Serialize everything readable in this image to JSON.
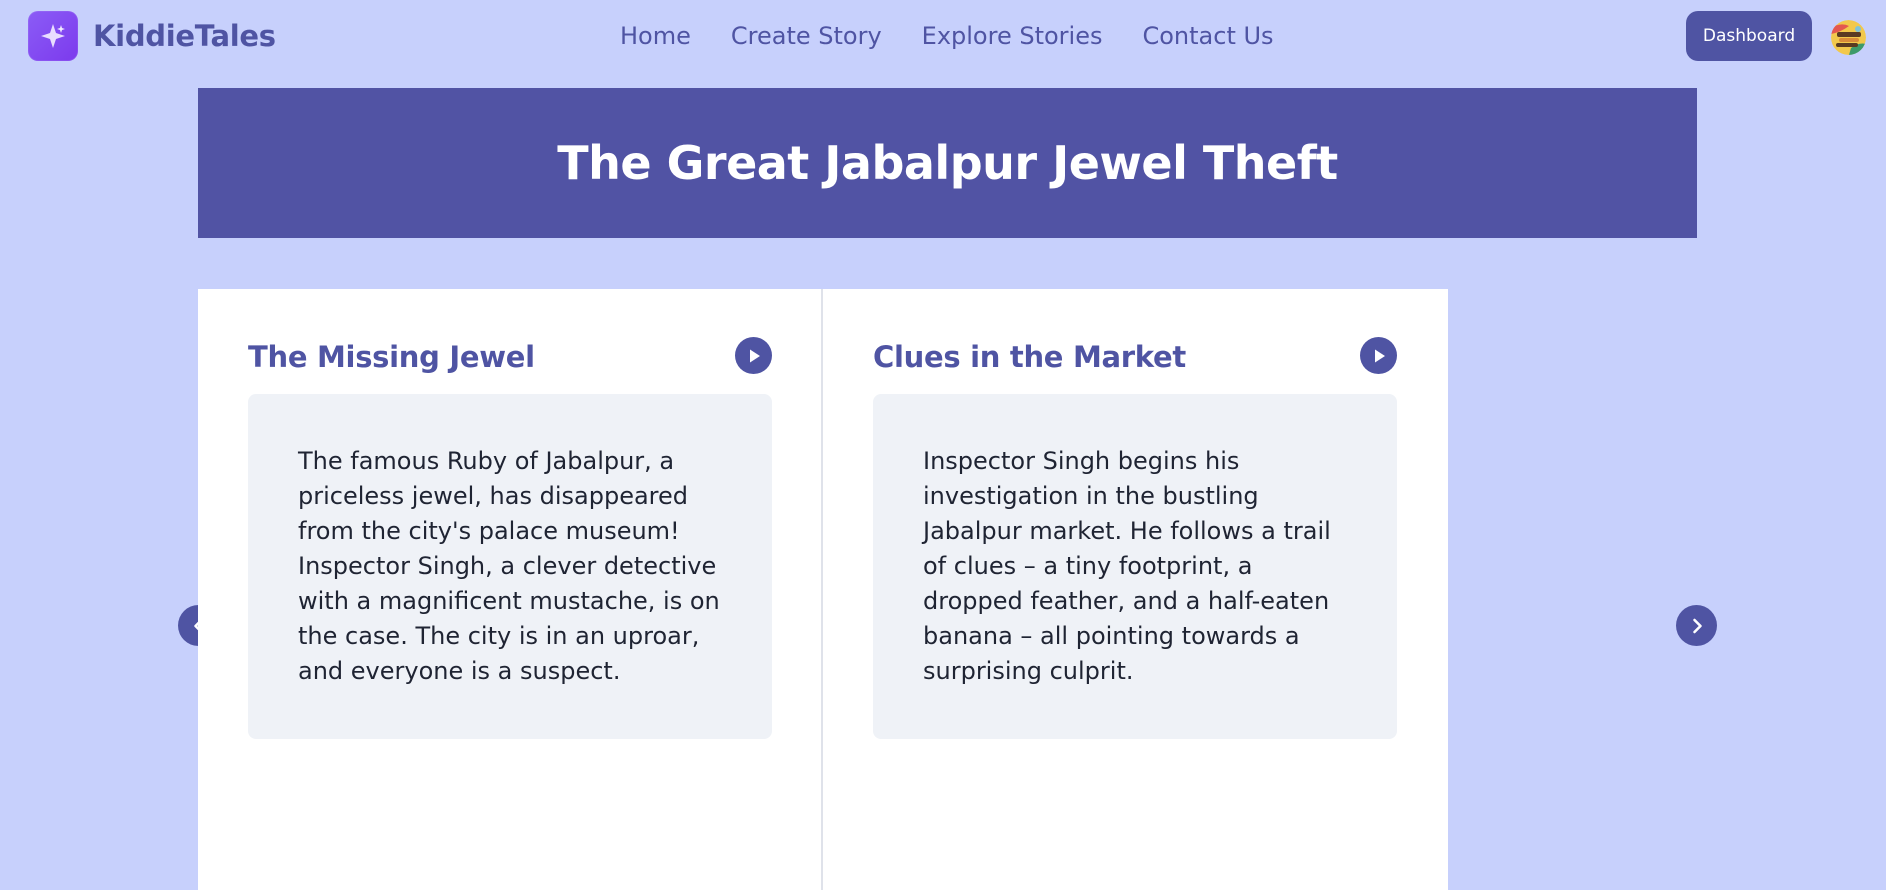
{
  "brand": {
    "name": "KiddieTales",
    "logo_icon": "sparkle-icon"
  },
  "nav": {
    "links": [
      "Home",
      "Create Story",
      "Explore Stories",
      "Contact Us"
    ],
    "dashboard_label": "Dashboard",
    "avatar_icon": "user-avatar"
  },
  "story": {
    "title": "The Great Jabalpur Jewel Theft",
    "pages": [
      {
        "title": "The Missing Jewel",
        "text": "The famous Ruby of Jabalpur, a priceless jewel, has disappeared from the city's palace museum! Inspector Singh, a clever detective with a magnificent mustache, is on the case. The city is in an uproar, and everyone is a suspect."
      },
      {
        "title": "Clues in the Market",
        "text": "Inspector Singh begins his investigation in the bustling Jabalpur market. He follows a trail of clues – a tiny footprint, a dropped feather, and a half-eaten banana – all pointing towards a surprising culprit."
      }
    ]
  },
  "controls": {
    "prev_icon": "chevron-left-icon",
    "next_icon": "chevron-right-icon",
    "play_icon": "play-icon"
  },
  "colors": {
    "background": "#c7d0fc",
    "accent": "#4f54a3",
    "hero": "#5153a4",
    "text_box": "#eff2f7",
    "logo_gradient_start": "#8b5cf6"
  }
}
